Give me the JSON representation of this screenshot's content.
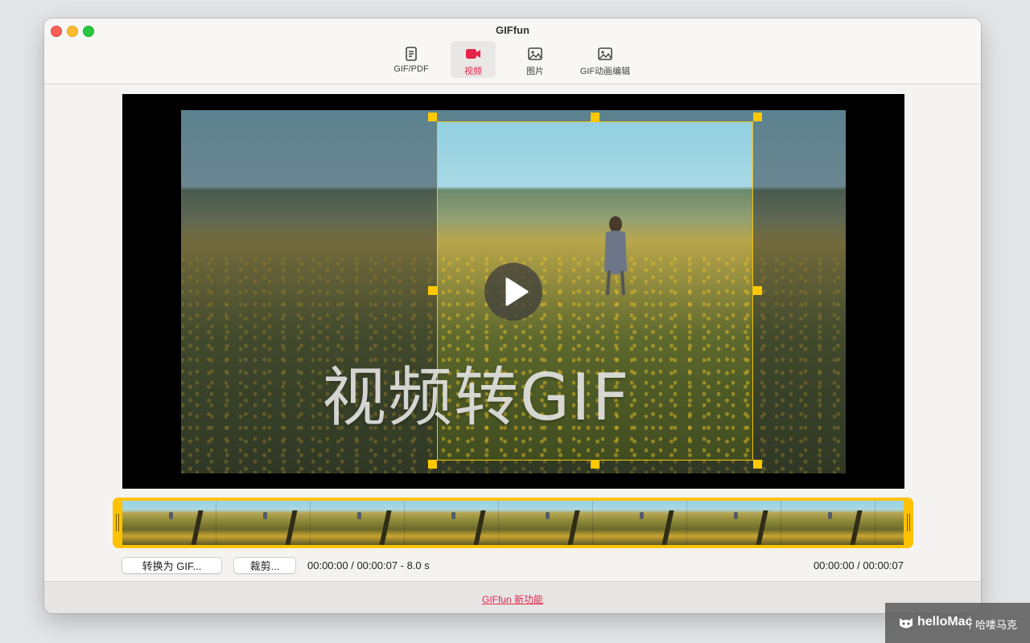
{
  "window": {
    "title": "GIFfun"
  },
  "toolbar": {
    "items": [
      {
        "label": "GIF/PDF",
        "icon": "document-icon",
        "active": false
      },
      {
        "label": "视频",
        "icon": "video-camera-icon",
        "active": true
      },
      {
        "label": "图片",
        "icon": "image-icon",
        "active": false
      },
      {
        "label": "GIF动画编辑",
        "icon": "image-edit-icon",
        "active": false
      }
    ]
  },
  "video": {
    "watermark_text": "视频转GIF"
  },
  "controls": {
    "convert_button": "转换为 GIF...",
    "crop_button": "裁剪...",
    "time_info": "00:00:00 / 00:00:07 - 8.0 s",
    "time_right": "00:00:00 / 00:00:07"
  },
  "footer": {
    "link": "GIFfun 新功能"
  },
  "overlay_badge": {
    "brand": "helloMac",
    "cn": "哈喽马克"
  },
  "colors": {
    "accent": "#e6244b",
    "crop_handle": "#ffc800",
    "timeline": "#ffc200"
  }
}
